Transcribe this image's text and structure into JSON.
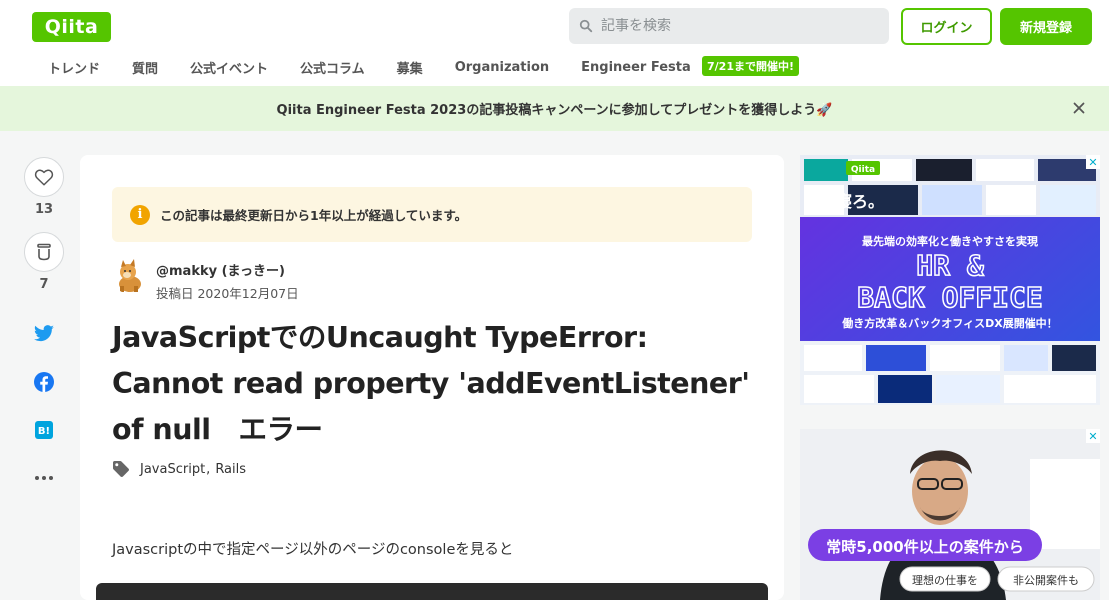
{
  "header": {
    "logo": "Qiita",
    "search_placeholder": "記事を検索",
    "login_label": "ログイン",
    "signup_label": "新規登録"
  },
  "nav": {
    "items": [
      "トレンド",
      "質問",
      "公式イベント",
      "公式コラム",
      "募集",
      "Organization",
      "Engineer Festa"
    ],
    "festa_badge": "7/21まで開催中!"
  },
  "banner": {
    "text": "Qiita Engineer Festa 2023の記事投稿キャンペーンに参加してプレゼントを獲得しよう🚀"
  },
  "actions": {
    "like_count": "13",
    "stock_count": "7"
  },
  "article": {
    "notice": "この記事は最終更新日から1年以上が経過しています。",
    "notice_icon": "i",
    "author": "@makky (まっきー)",
    "posted": "投稿日 2020年12月07日",
    "title": "JavaScriptでのUncaught TypeError: Cannot read property 'addEventListener' of null　エラー",
    "tags": [
      "JavaScript",
      "Rails"
    ],
    "body_first_line": "Javascriptの中で指定ページ以外のページのconsoleを見ると"
  },
  "ads": {
    "ad1": {
      "brand": "Qiita",
      "headline_small": "寝ろ。",
      "subtitle": "最先端の効率化と働きやすさを実現",
      "big_line1": "HR &",
      "big_line2": "BACK OFFICE",
      "bottom": "働き方改革＆バックオフィスDX展開催中！"
    },
    "ad2": {
      "catch": "常時5,000件以上の案件から",
      "pill1": "理想の仕事を",
      "pill2": "非公開案件も"
    }
  },
  "colors": {
    "brand_green": "#55c500",
    "banner_bg": "#e5f6dc",
    "notice_bg": "#fdf6e1",
    "twitter": "#1d9bf0",
    "facebook": "#1877f2",
    "hatena": "#00a4de"
  }
}
